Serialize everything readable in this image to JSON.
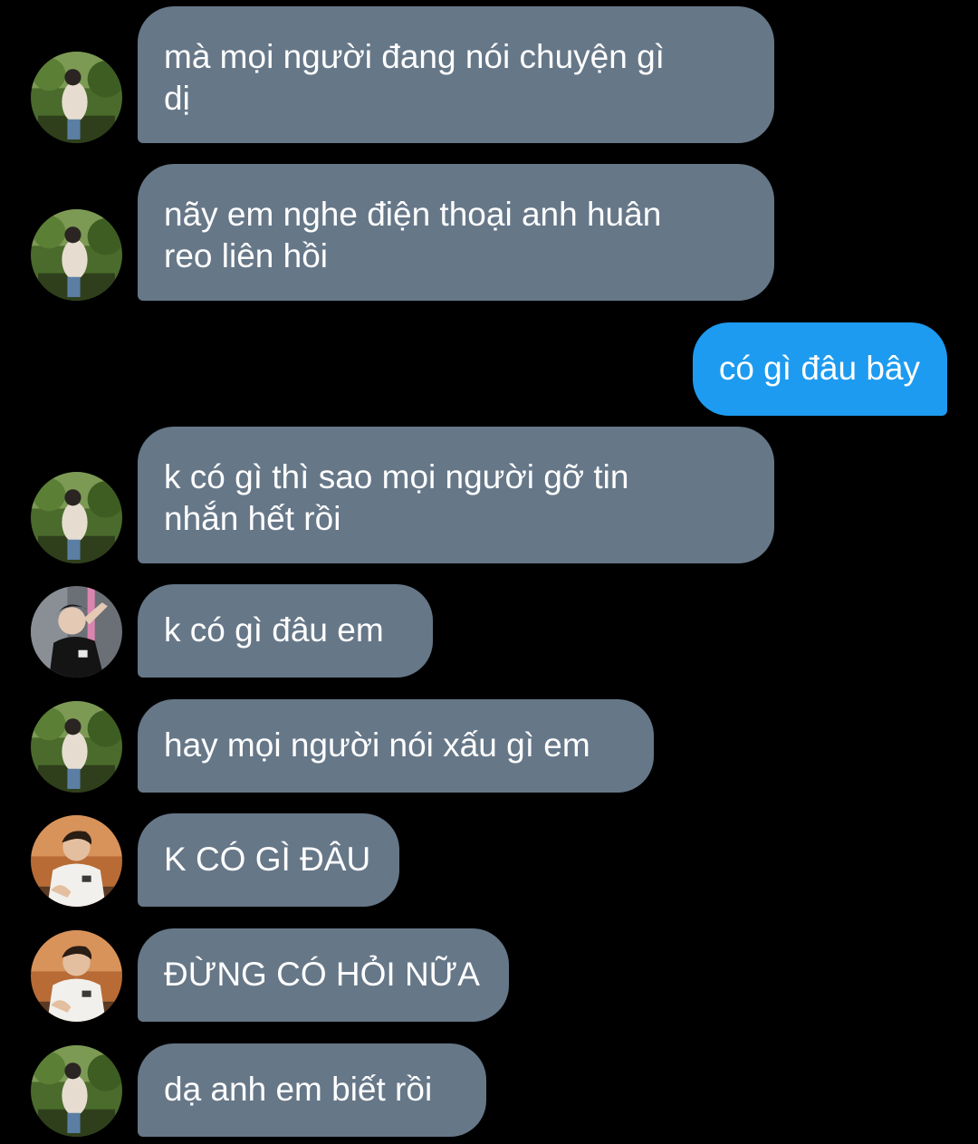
{
  "messages": [
    {
      "side": "in",
      "avatar": "avatar-green-jacket",
      "text_lines": [
        "mà mọi người đang nói chuyện gì",
        "dị"
      ]
    },
    {
      "side": "in",
      "avatar": "avatar-green-jacket",
      "text_lines": [
        "nãy em nghe điện thoại anh huân",
        "reo liên hồi"
      ]
    },
    {
      "side": "out",
      "text_lines": [
        "có gì đâu bây"
      ]
    },
    {
      "side": "in",
      "avatar": "avatar-green-jacket",
      "text_lines": [
        "k có gì thì sao mọi người gỡ tin",
        "nhắn hết rồi"
      ]
    },
    {
      "side": "in",
      "avatar": "avatar-black-shirt",
      "text_lines": [
        "k có gì đâu em"
      ]
    },
    {
      "side": "in",
      "avatar": "avatar-green-jacket",
      "text_lines": [
        "hay mọi người nói xấu gì em"
      ]
    },
    {
      "side": "in",
      "avatar": "avatar-white-shirt",
      "text_lines": [
        "K CÓ GÌ ĐÂU"
      ]
    },
    {
      "side": "in",
      "avatar": "avatar-white-shirt",
      "text_lines": [
        "ĐỪNG CÓ HỎI NỮA"
      ]
    },
    {
      "side": "in",
      "avatar": "avatar-green-jacket",
      "text_lines": [
        "dạ anh em biết rồi"
      ]
    }
  ],
  "colors": {
    "background": "#000000",
    "incoming_bubble": "#667788",
    "outgoing_bubble": "#1d9bf0",
    "text": "#ffffff"
  }
}
